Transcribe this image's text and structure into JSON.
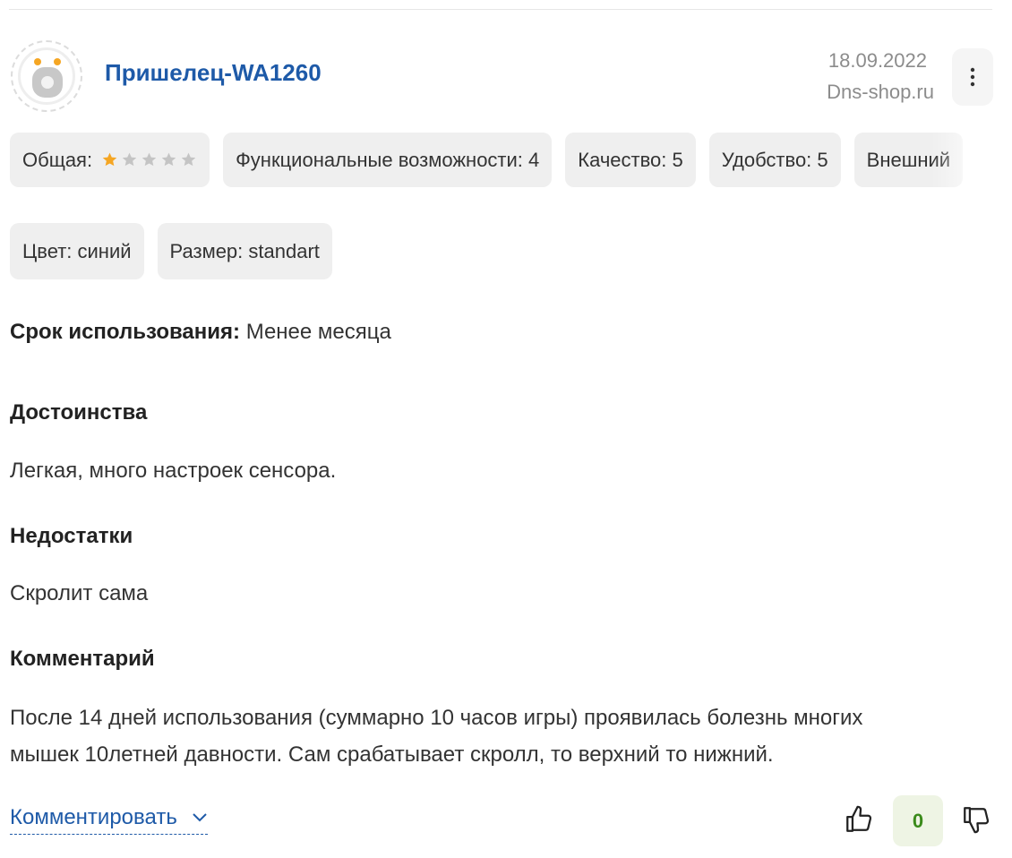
{
  "review": {
    "author": "Пришелец-WA1260",
    "date": "18.09.2022",
    "source": "Dns-shop.ru",
    "ratings": {
      "overall_label": "Общая:",
      "overall_stars": 1,
      "overall_stars_max": 5,
      "functionality": "Функциональные возможности: 4",
      "quality": "Качество: 5",
      "convenience": "Удобство: 5",
      "appearance": "Внешний"
    },
    "attributes": {
      "color": "Цвет: синий",
      "size": "Размер: standart"
    },
    "usage": {
      "label": "Срок использования:",
      "value": "Менее месяца"
    },
    "pros": {
      "title": "Достоинства",
      "text": "Легкая, много настроек сенсора."
    },
    "cons": {
      "title": "Недостатки",
      "text": "Скролит сама"
    },
    "comment": {
      "title": "Комментарий",
      "line1": "После 14 дней использования (суммарно 10 часов игры) проявилась болезнь многих",
      "line2": "мышек 10летней давности. Сам срабатывает скролл, то верхний то нижний."
    },
    "footer": {
      "comment_link": "Комментировать",
      "votes": "0"
    }
  },
  "colors": {
    "accent": "#1e5aa8",
    "star_active": "#f5a623",
    "star_inactive": "#c4c4c4",
    "vote_positive": "#3a8a1a"
  },
  "icons": [
    "avatar-alien-icon",
    "more-vertical-icon",
    "star-icon",
    "chevron-down-icon",
    "thumb-up-icon",
    "thumb-down-icon"
  ]
}
